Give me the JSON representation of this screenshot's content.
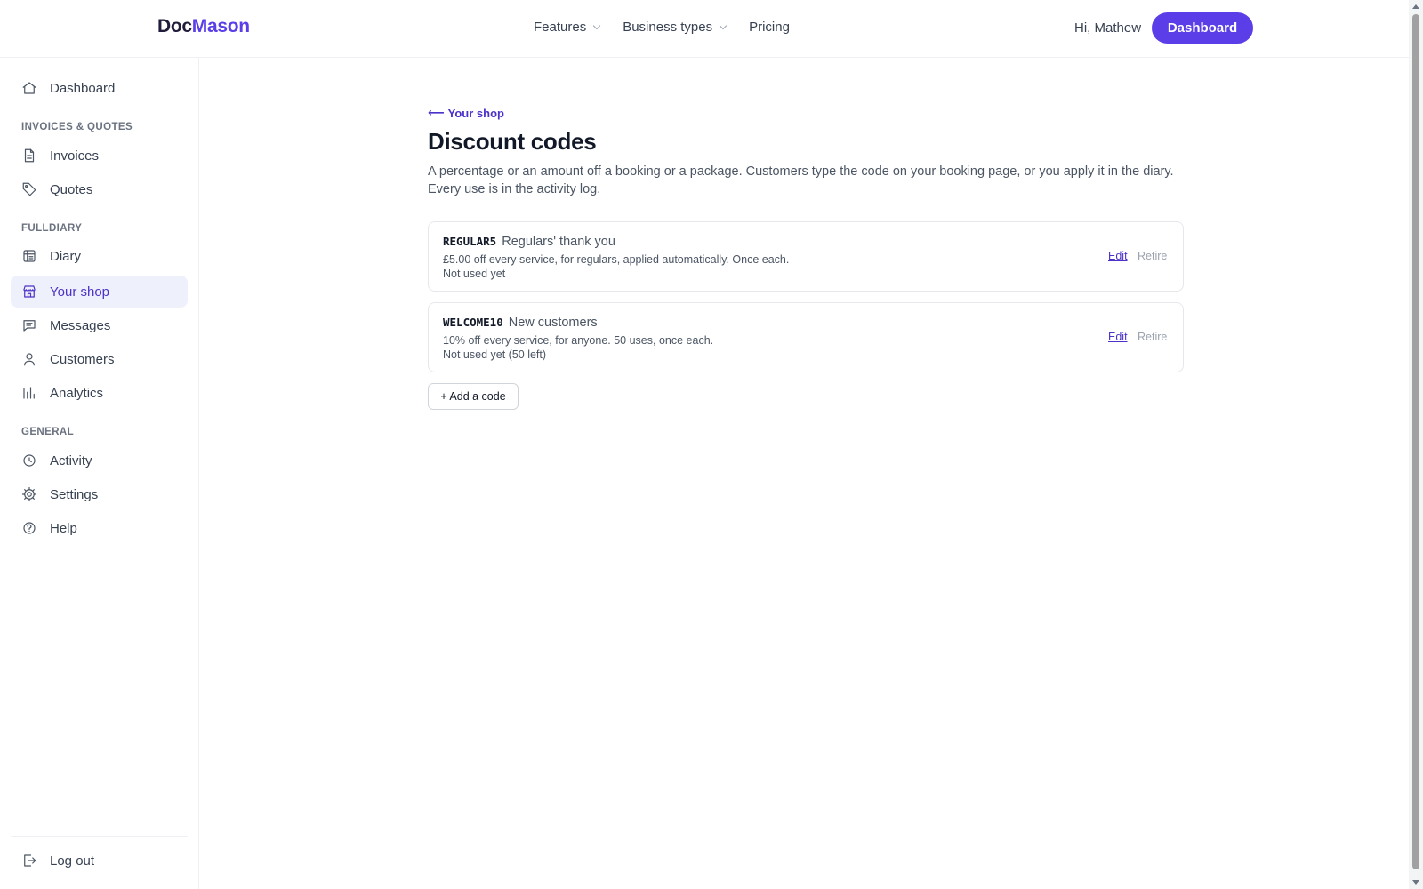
{
  "brand": {
    "part1": "Doc",
    "part2": "Mason"
  },
  "topnav": {
    "links": [
      {
        "label": "Features",
        "has_dropdown": true
      },
      {
        "label": "Business types",
        "has_dropdown": true
      },
      {
        "label": "Pricing",
        "has_dropdown": false
      }
    ],
    "greeting": "Hi, Mathew",
    "dashboard_button": "Dashboard"
  },
  "sidebar": {
    "dashboard": {
      "label": "Dashboard",
      "icon": "home-icon"
    },
    "sections": [
      {
        "heading": "INVOICES & QUOTES",
        "items": [
          {
            "label": "Invoices",
            "icon": "file-icon"
          },
          {
            "label": "Quotes",
            "icon": "tag-icon"
          }
        ]
      },
      {
        "heading": "FULLDIARY",
        "items": [
          {
            "label": "Diary",
            "icon": "calendar-icon"
          },
          {
            "label": "Your shop",
            "icon": "store-icon",
            "active": true
          },
          {
            "label": "Messages",
            "icon": "message-icon"
          },
          {
            "label": "Customers",
            "icon": "user-icon"
          },
          {
            "label": "Analytics",
            "icon": "bar-chart-icon"
          }
        ]
      },
      {
        "heading": "GENERAL",
        "items": [
          {
            "label": "Activity",
            "icon": "clock-icon"
          },
          {
            "label": "Settings",
            "icon": "gear-icon"
          },
          {
            "label": "Help",
            "icon": "help-icon"
          }
        ]
      }
    ],
    "logout": {
      "label": "Log out",
      "icon": "logout-icon"
    }
  },
  "main": {
    "back_link": "Your shop",
    "title": "Discount codes",
    "description": "A percentage or an amount off a booking or a package. Customers type the code on your booking page, or you apply it in the diary. Every use is in the activity log.",
    "codes": [
      {
        "code": "REGULAR5",
        "name": "Regulars' thank you",
        "details": "£5.00 off every service, for regulars, applied automatically. Once each.",
        "usage": "Not used yet",
        "edit_label": "Edit",
        "retire_label": "Retire"
      },
      {
        "code": "WELCOME10",
        "name": "New customers",
        "details": "10% off every service, for anyone. 50 uses, once each.",
        "usage": "Not used yet (50 left)",
        "edit_label": "Edit",
        "retire_label": "Retire"
      }
    ],
    "add_button": "+ Add a code"
  },
  "colors": {
    "accent": "#5b3ee8",
    "active_bg": "#eef0fb",
    "active_text": "#4c32c8"
  }
}
